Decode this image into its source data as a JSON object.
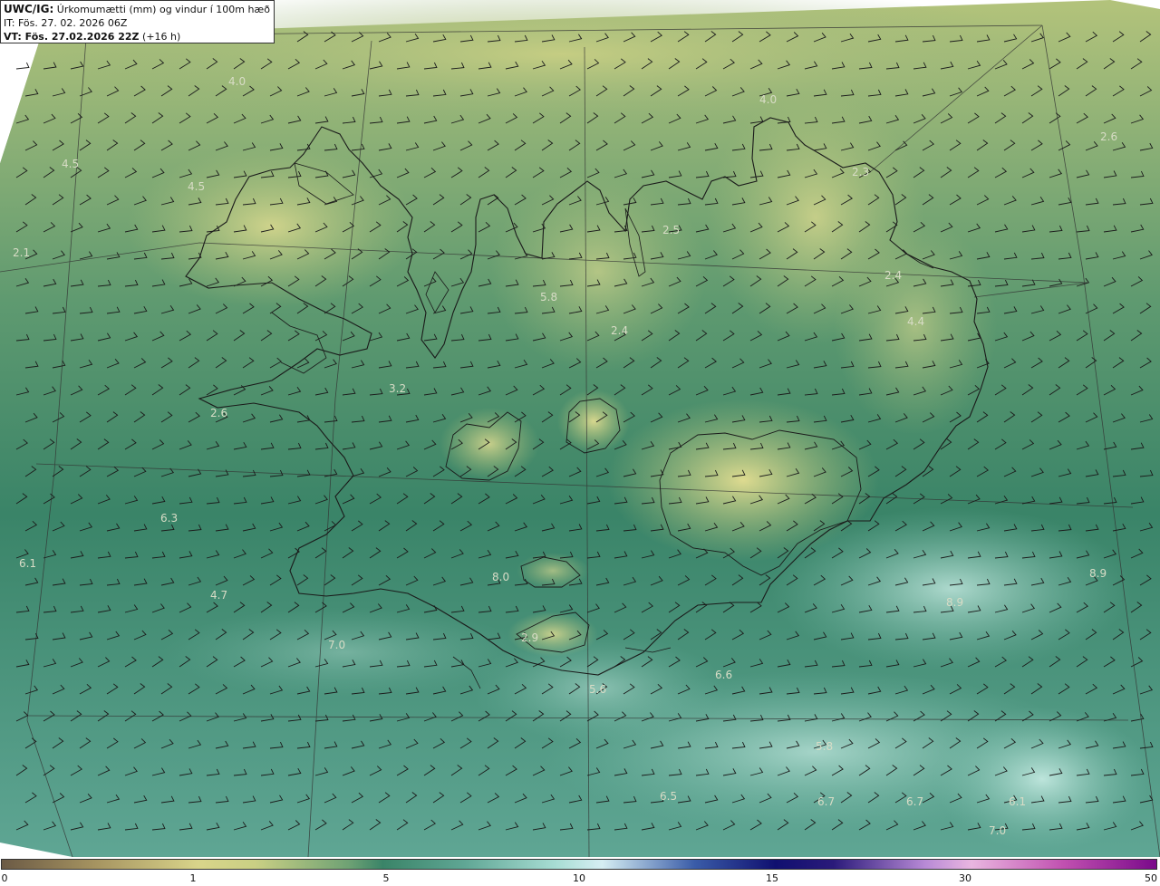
{
  "header": {
    "title_prefix": "UWC/IG:",
    "title_rest": "Úrkomumætti (mm) og vindur í 100m hæð",
    "it_line": "IT: Fös. 27. 02. 2026 06Z",
    "vt_prefix": "VT: Fös. 27.02.2026 22Z",
    "vt_suffix": "(+16 h)"
  },
  "colors": {
    "land_light": "#d9d98a",
    "land_mid": "#9fbc6e",
    "sea_dark": "#2f7560",
    "sea_mid": "#3e8a72",
    "sea_light": "#8ac9bd",
    "sea_pale": "#c0e6df",
    "coast": "#1a1a1a"
  },
  "value_labels": [
    {
      "id": "v1",
      "text": "4.0"
    },
    {
      "id": "v2",
      "text": "4.0"
    },
    {
      "id": "v3",
      "text": "2.6"
    },
    {
      "id": "v4",
      "text": "4.5"
    },
    {
      "id": "v5",
      "text": "4.5"
    },
    {
      "id": "v6",
      "text": "2.1"
    },
    {
      "id": "v7",
      "text": "2.3"
    },
    {
      "id": "v8",
      "text": "2.5"
    },
    {
      "id": "v9",
      "text": "2.4"
    },
    {
      "id": "v10",
      "text": "5.8"
    },
    {
      "id": "v11",
      "text": "4.4"
    },
    {
      "id": "v12",
      "text": "2.4"
    },
    {
      "id": "v13",
      "text": "3.2"
    },
    {
      "id": "v14",
      "text": "2.6"
    },
    {
      "id": "v15",
      "text": "6.3"
    },
    {
      "id": "v16",
      "text": "6.1"
    },
    {
      "id": "v17",
      "text": "8.0"
    },
    {
      "id": "v18",
      "text": "4.7"
    },
    {
      "id": "v19",
      "text": "7.0"
    },
    {
      "id": "v20",
      "text": "2.9"
    },
    {
      "id": "v21",
      "text": "6.6"
    },
    {
      "id": "v22",
      "text": "5.6"
    },
    {
      "id": "v23",
      "text": "8.9"
    },
    {
      "id": "v24",
      "text": "8.9"
    },
    {
      "id": "v25",
      "text": "5.8"
    },
    {
      "id": "v26",
      "text": "6.5"
    },
    {
      "id": "v27",
      "text": "6.7"
    },
    {
      "id": "v28",
      "text": "6.7"
    },
    {
      "id": "v29",
      "text": "6.1"
    },
    {
      "id": "v30",
      "text": "7.0"
    }
  ],
  "colorbar": {
    "ticks": [
      "0",
      "1",
      "5",
      "10",
      "15",
      "30",
      "50"
    ]
  }
}
